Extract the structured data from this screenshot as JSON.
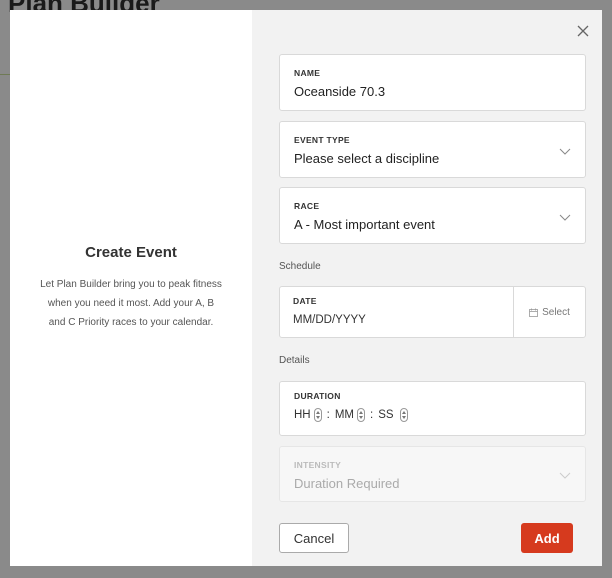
{
  "background": {
    "title": "Plan Builder"
  },
  "intro": {
    "title": "Create Event",
    "text": "Let Plan Builder bring you to peak fitness when you need it most. Add your A, B and C Priority races to your calendar."
  },
  "form": {
    "name": {
      "label": "NAME",
      "value": "Oceanside 70.3"
    },
    "event_type": {
      "label": "EVENT TYPE",
      "value": "Please select a discipline"
    },
    "race": {
      "label": "RACE",
      "value": "A - Most important event"
    },
    "schedule_label": "Schedule",
    "date": {
      "label": "DATE",
      "placeholder": "MM/DD/YYYY",
      "select_label": "Select"
    },
    "details_label": "Details",
    "duration": {
      "label": "DURATION",
      "hh": "HH",
      "mm": "MM",
      "ss": "SS",
      "sep": ":"
    },
    "intensity": {
      "label": "INTENSITY",
      "value": "Duration Required"
    }
  },
  "buttons": {
    "cancel": "Cancel",
    "add": "Add"
  },
  "colors": {
    "accent": "#d63a1e",
    "panel": "#f2f2f2"
  }
}
